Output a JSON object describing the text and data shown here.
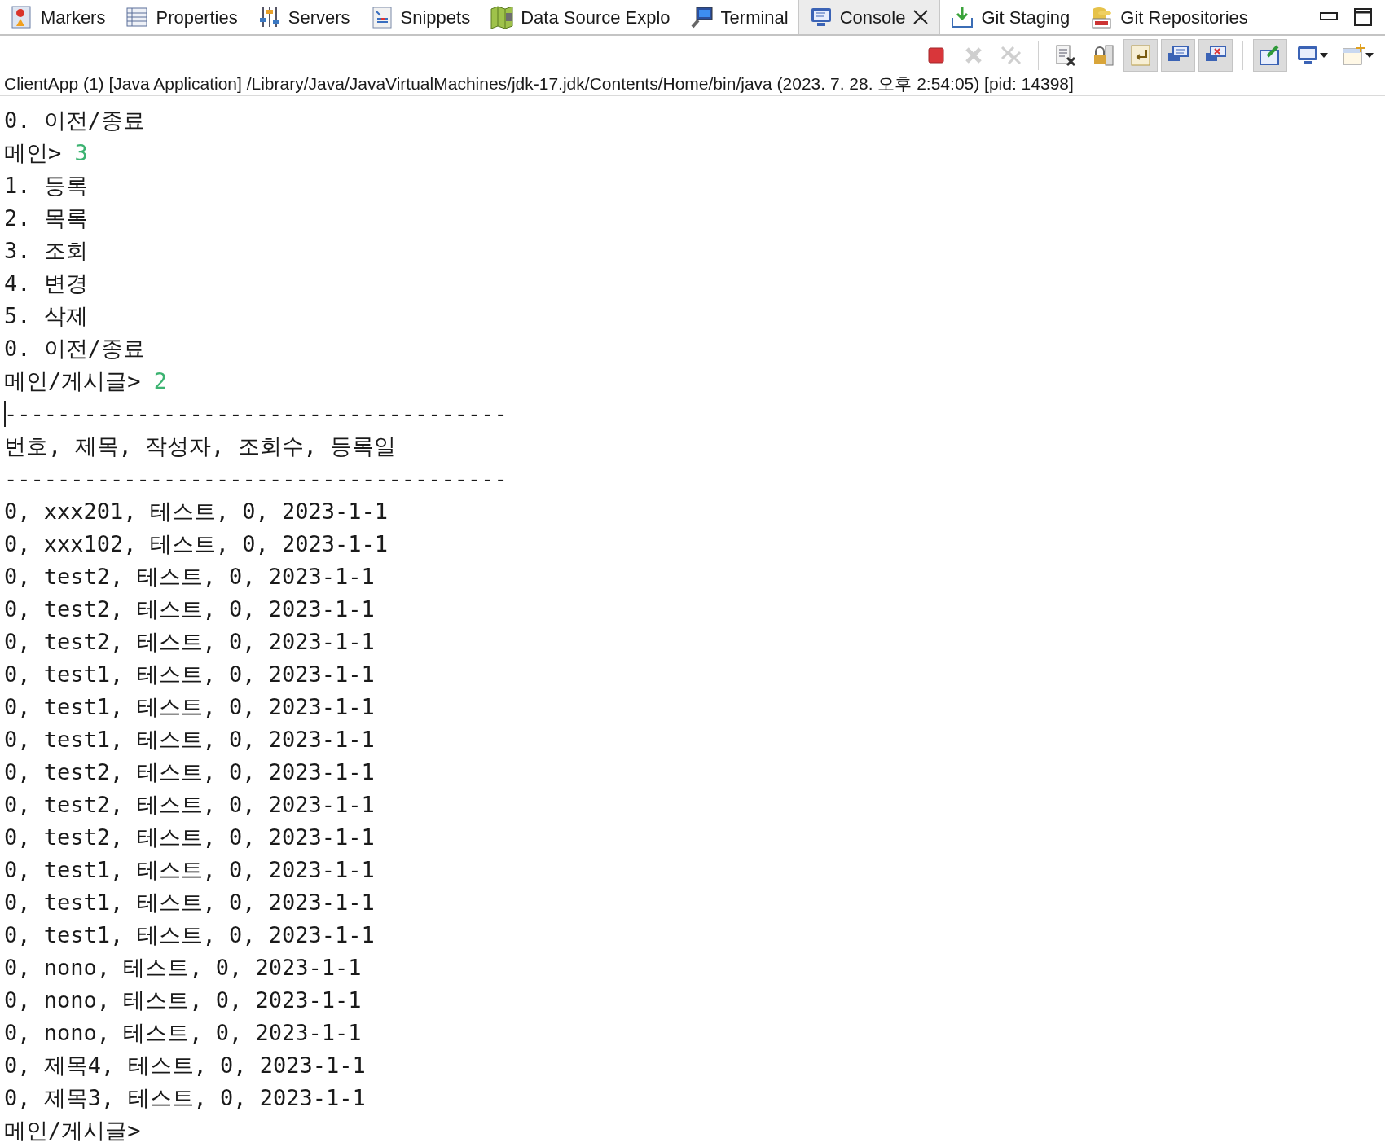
{
  "tabs": [
    {
      "kind": "markers",
      "label": "Markers",
      "selected": false
    },
    {
      "kind": "properties",
      "label": "Properties",
      "selected": false
    },
    {
      "kind": "servers",
      "label": "Servers",
      "selected": false
    },
    {
      "kind": "snippets",
      "label": "Snippets",
      "selected": false
    },
    {
      "kind": "datasource",
      "label": "Data Source Explo",
      "selected": false
    },
    {
      "kind": "terminal",
      "label": "Terminal",
      "selected": false
    },
    {
      "kind": "console",
      "label": "Console",
      "selected": true
    },
    {
      "kind": "gitstaging",
      "label": "Git Staging",
      "selected": false
    },
    {
      "kind": "gitrepos",
      "label": "Git Repositories",
      "selected": false
    }
  ],
  "toolbar": [
    {
      "kind": "stop",
      "disabled": false
    },
    {
      "kind": "remove",
      "disabled": true
    },
    {
      "kind": "remove-all",
      "disabled": true
    },
    {
      "kind": "separator"
    },
    {
      "kind": "clear"
    },
    {
      "kind": "scroll-lock",
      "on": false
    },
    {
      "kind": "word-wrap",
      "on": true
    },
    {
      "kind": "stdout",
      "on": true
    },
    {
      "kind": "stderr",
      "on": true
    },
    {
      "kind": "separator"
    },
    {
      "kind": "pin",
      "on": true
    },
    {
      "kind": "display-console"
    },
    {
      "kind": "new-console"
    }
  ],
  "console": {
    "process": "ClientApp (1) [Java Application] /Library/Java/JavaVirtualMachines/jdk-17.jdk/Contents/Home/bin/java  (2023. 7. 28. 오후 2:54:05) [pid: 14398]",
    "lines": [
      {
        "text": "0. 이전/종료"
      },
      {
        "text": "메인> ",
        "input": "3"
      },
      {
        "text": "1. 등록"
      },
      {
        "text": "2. 목록"
      },
      {
        "text": "3. 조회"
      },
      {
        "text": "4. 변경"
      },
      {
        "text": "5. 삭제"
      },
      {
        "text": "0. 이전/종료"
      },
      {
        "text": "메인/게시글> ",
        "input": "2"
      },
      {
        "text": "--------------------------------------",
        "cursor": true
      },
      {
        "text": "번호, 제목, 작성자, 조회수, 등록일"
      },
      {
        "text": "--------------------------------------"
      },
      {
        "text": "0, xxx201, 테스트, 0, 2023-1-1"
      },
      {
        "text": "0, xxx102, 테스트, 0, 2023-1-1"
      },
      {
        "text": "0, test2, 테스트, 0, 2023-1-1"
      },
      {
        "text": "0, test2, 테스트, 0, 2023-1-1"
      },
      {
        "text": "0, test2, 테스트, 0, 2023-1-1"
      },
      {
        "text": "0, test1, 테스트, 0, 2023-1-1"
      },
      {
        "text": "0, test1, 테스트, 0, 2023-1-1"
      },
      {
        "text": "0, test1, 테스트, 0, 2023-1-1"
      },
      {
        "text": "0, test2, 테스트, 0, 2023-1-1"
      },
      {
        "text": "0, test2, 테스트, 0, 2023-1-1"
      },
      {
        "text": "0, test2, 테스트, 0, 2023-1-1"
      },
      {
        "text": "0, test1, 테스트, 0, 2023-1-1"
      },
      {
        "text": "0, test1, 테스트, 0, 2023-1-1"
      },
      {
        "text": "0, test1, 테스트, 0, 2023-1-1"
      },
      {
        "text": "0, nono, 테스트, 0, 2023-1-1"
      },
      {
        "text": "0, nono, 테스트, 0, 2023-1-1"
      },
      {
        "text": "0, nono, 테스트, 0, 2023-1-1"
      },
      {
        "text": "0, 제목4, 테스트, 0, 2023-1-1"
      },
      {
        "text": "0, 제목3, 테스트, 0, 2023-1-1"
      },
      {
        "text": "메인/게시글>"
      }
    ]
  }
}
